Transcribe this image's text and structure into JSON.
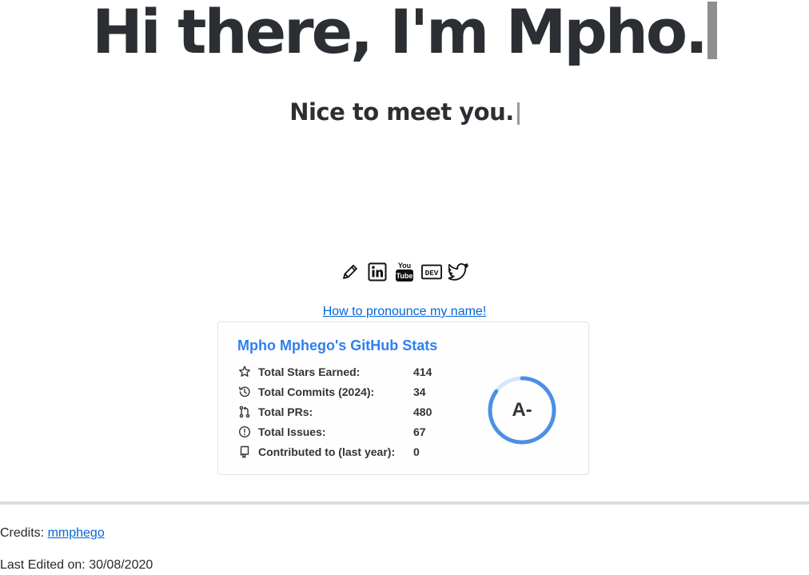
{
  "header": {
    "headline": "Hi there, I'm Mpho.",
    "subline": "Nice to meet you."
  },
  "social": [
    {
      "icon": "pencil-icon",
      "title": "Blog"
    },
    {
      "icon": "linkedin-icon",
      "title": "LinkedIn"
    },
    {
      "icon": "youtube-icon",
      "title": "YouTube"
    },
    {
      "icon": "dev-icon",
      "title": "DEV"
    },
    {
      "icon": "twitter-icon",
      "title": "Twitter"
    }
  ],
  "pronounce_link": "How to pronounce my name!",
  "stats_card": {
    "title": "Mpho Mphego's GitHub Stats",
    "title_color": "#2f80ed",
    "rows": [
      {
        "icon": "star-icon",
        "label": "Total Stars Earned:",
        "value": "414"
      },
      {
        "icon": "history-icon",
        "label": "Total Commits (2024):",
        "value": "34"
      },
      {
        "icon": "pull-request-icon",
        "label": "Total PRs:",
        "value": "480"
      },
      {
        "icon": "issue-icon",
        "label": "Total Issues:",
        "value": "67"
      },
      {
        "icon": "repo-icon",
        "label": "Contributed to (last year):",
        "value": "0"
      }
    ],
    "rank": "A-",
    "rank_progress": 0.85,
    "ring_color": "#4c8fe6"
  },
  "footer": {
    "credits_label": "Credits:",
    "credits_link": "mmphego",
    "last_edited": "Last Edited on: 30/08/2020"
  }
}
